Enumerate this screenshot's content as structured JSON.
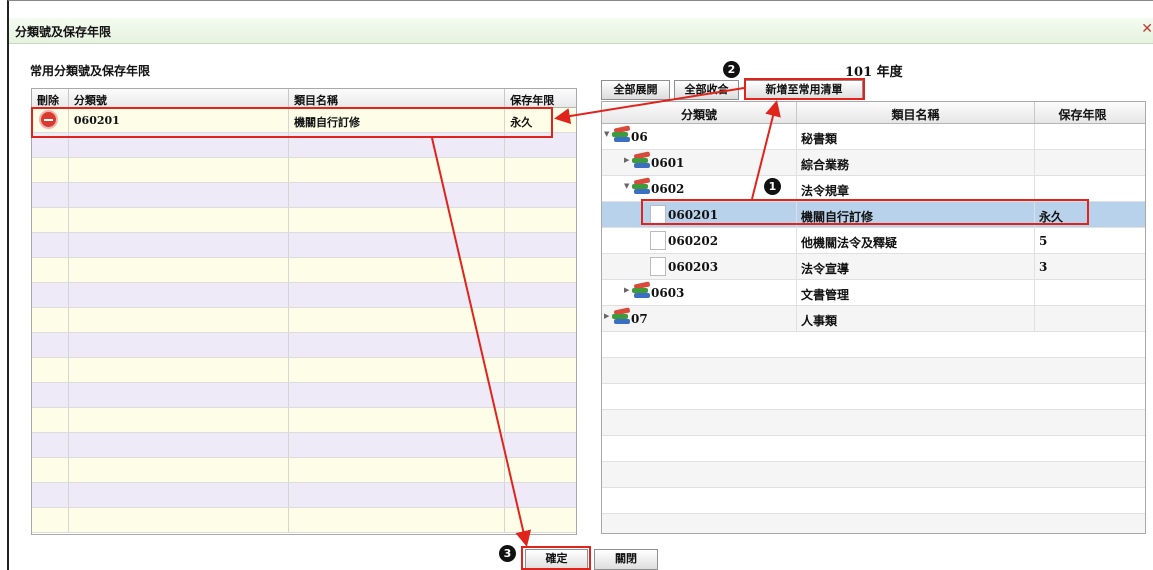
{
  "window": {
    "title": "分類號及保存年限",
    "close_icon": "close-icon"
  },
  "left": {
    "title": "常用分類號及保存年限",
    "headers": [
      "刪除",
      "分類號",
      "類目名稱",
      "保存年限"
    ],
    "rows": [
      {
        "code": "060201",
        "name": "機關自行訂修",
        "years": "永久"
      }
    ]
  },
  "right": {
    "year_label": "101 年度",
    "toolbar": {
      "expand_all": "全部展開",
      "collapse_all": "全部收合",
      "add_common": "新增至常用清單"
    },
    "headers": [
      "分類號",
      "類目名稱",
      "保存年限"
    ],
    "tree": [
      {
        "code": "06",
        "name": "秘書類",
        "years": "",
        "level": 0,
        "type": "folder",
        "expanded": true
      },
      {
        "code": "0601",
        "name": "綜合業務",
        "years": "",
        "level": 1,
        "type": "folder",
        "expanded": false
      },
      {
        "code": "0602",
        "name": "法令規章",
        "years": "",
        "level": 1,
        "type": "folder",
        "expanded": true
      },
      {
        "code": "060201",
        "name": "機關自行訂修",
        "years": "永久",
        "level": 2,
        "type": "leaf",
        "selected": true
      },
      {
        "code": "060202",
        "name": "他機關法令及釋疑",
        "years": "5",
        "level": 2,
        "type": "leaf"
      },
      {
        "code": "060203",
        "name": "法令宣導",
        "years": "3",
        "level": 2,
        "type": "leaf"
      },
      {
        "code": "0603",
        "name": "文書管理",
        "years": "",
        "level": 1,
        "type": "folder",
        "expanded": false
      },
      {
        "code": "07",
        "name": "人事類",
        "years": "",
        "level": 0,
        "type": "folder",
        "expanded": false
      }
    ]
  },
  "buttons": {
    "ok": "確定",
    "close": "關閉"
  },
  "annotations": {
    "step1": "1",
    "step2": "2",
    "step3": "3",
    "color": "#e0241b"
  },
  "colors": {
    "selected_row": "#b9d2ec",
    "odd_row": "#fdfde8",
    "even_row": "#efeaf7",
    "delete": "#d83a2e"
  }
}
